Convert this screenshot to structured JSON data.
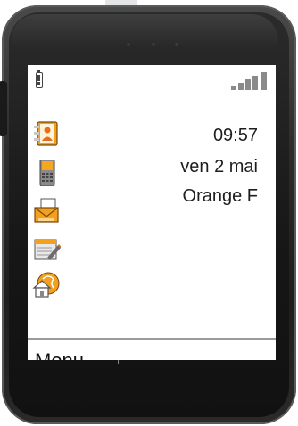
{
  "status": {
    "time": "09:57",
    "date": "ven 2 mai",
    "operator": "Orange F",
    "battery_icon": "battery-icon",
    "signal_icon": "signal-strength-icon"
  },
  "shortcuts": [
    {
      "name": "contacts-icon"
    },
    {
      "name": "phone-icon"
    },
    {
      "name": "message-icon"
    },
    {
      "name": "organizer-icon"
    },
    {
      "name": "home-network-icon"
    }
  ],
  "softkey": {
    "left_label": "Menu"
  },
  "colors": {
    "accent": "#f5a623",
    "text": "#1e1e1e"
  }
}
